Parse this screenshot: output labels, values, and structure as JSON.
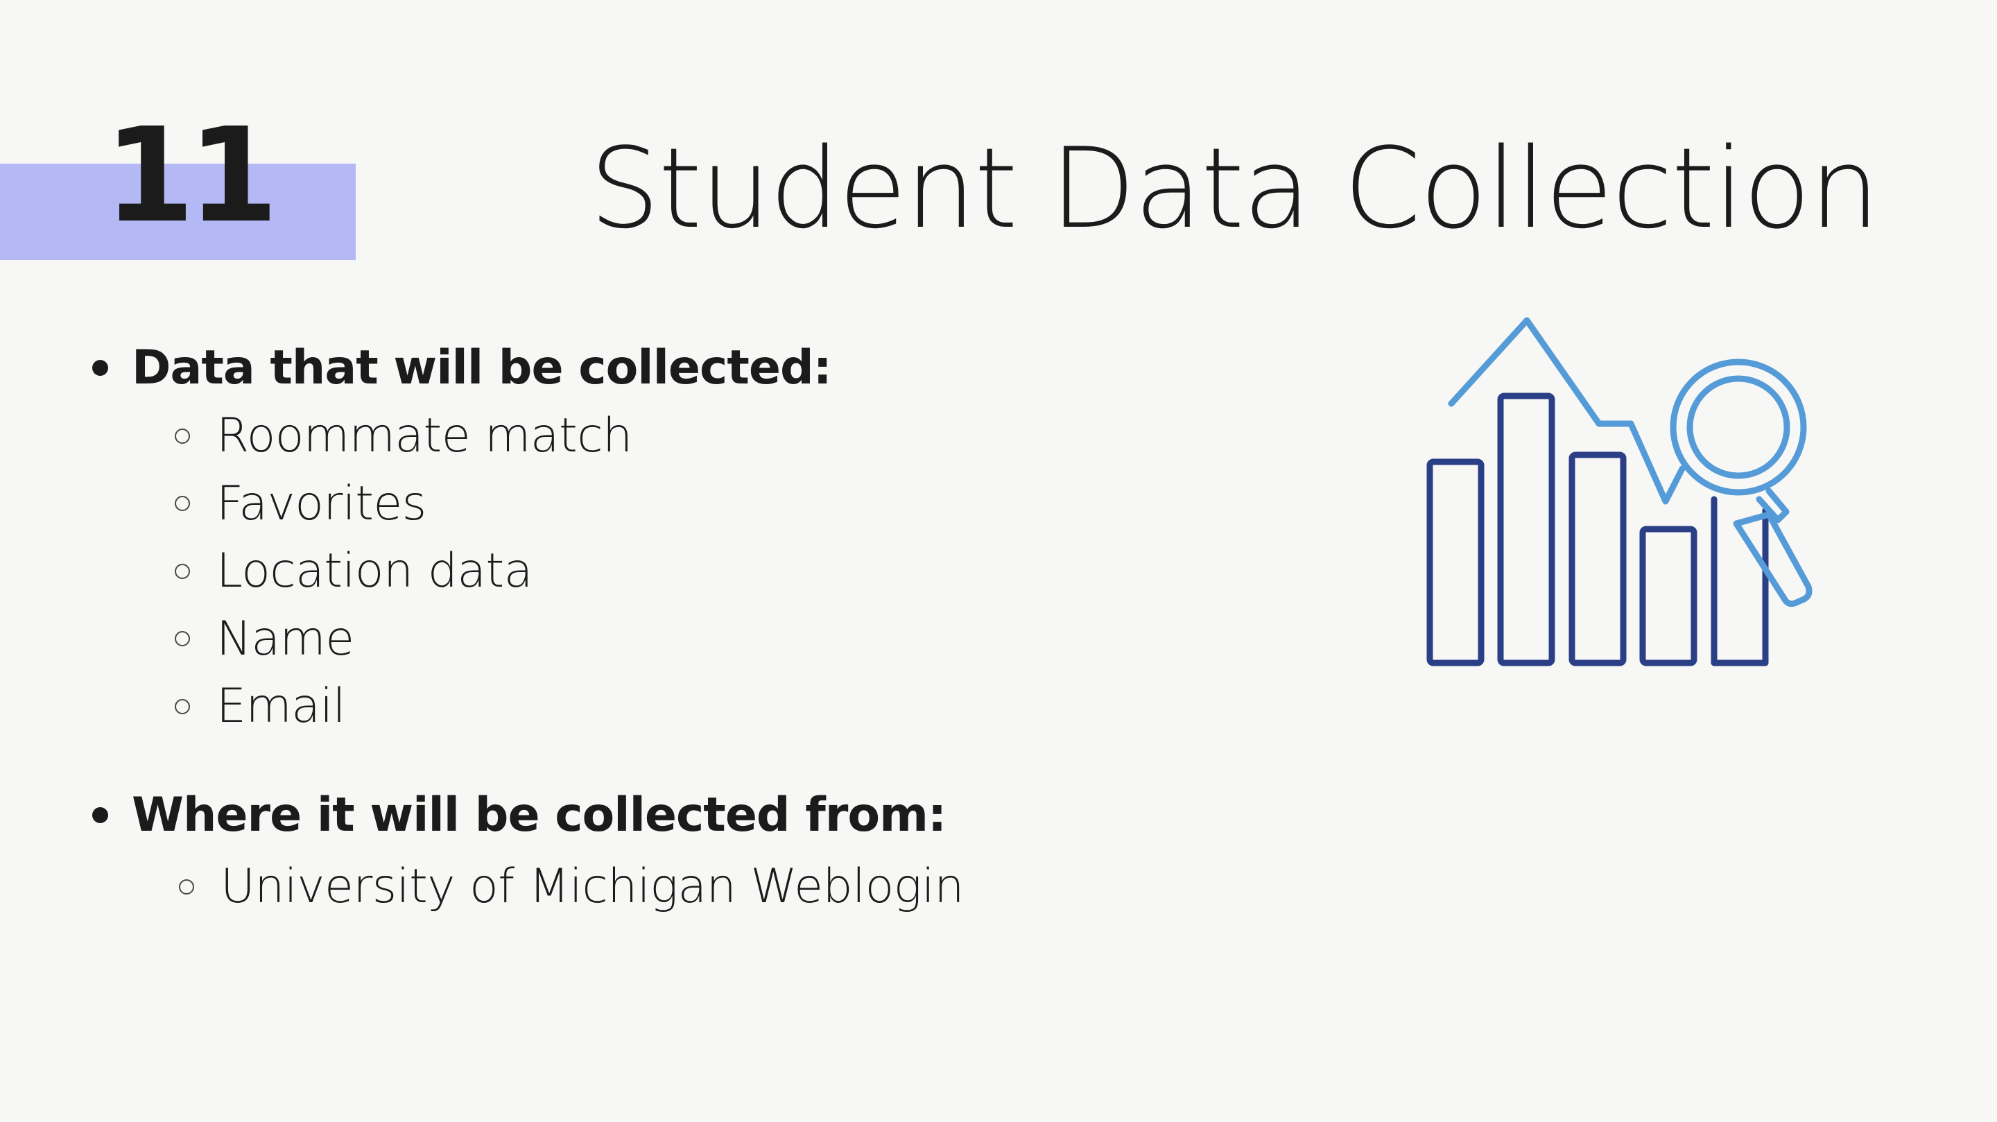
{
  "slide": {
    "number": "11",
    "title": "Student Data Collection"
  },
  "sections": [
    {
      "heading": "Data that will be collected:",
      "items": [
        "Roommate match",
        "Favorites",
        "Location data",
        "Name",
        "Email"
      ]
    },
    {
      "heading": "Where it will be collected from:",
      "items": [
        "University of Michigan Weblogin"
      ]
    }
  ],
  "illustration": {
    "icon": "bar-chart-magnifier-icon",
    "colors": {
      "bars": "#2b3f86",
      "trend_and_magnifier": "#549bd8"
    }
  },
  "colors": {
    "background": "#f7f7f5",
    "number_band": "#b4b8f4",
    "text": "#1b1b1b"
  }
}
